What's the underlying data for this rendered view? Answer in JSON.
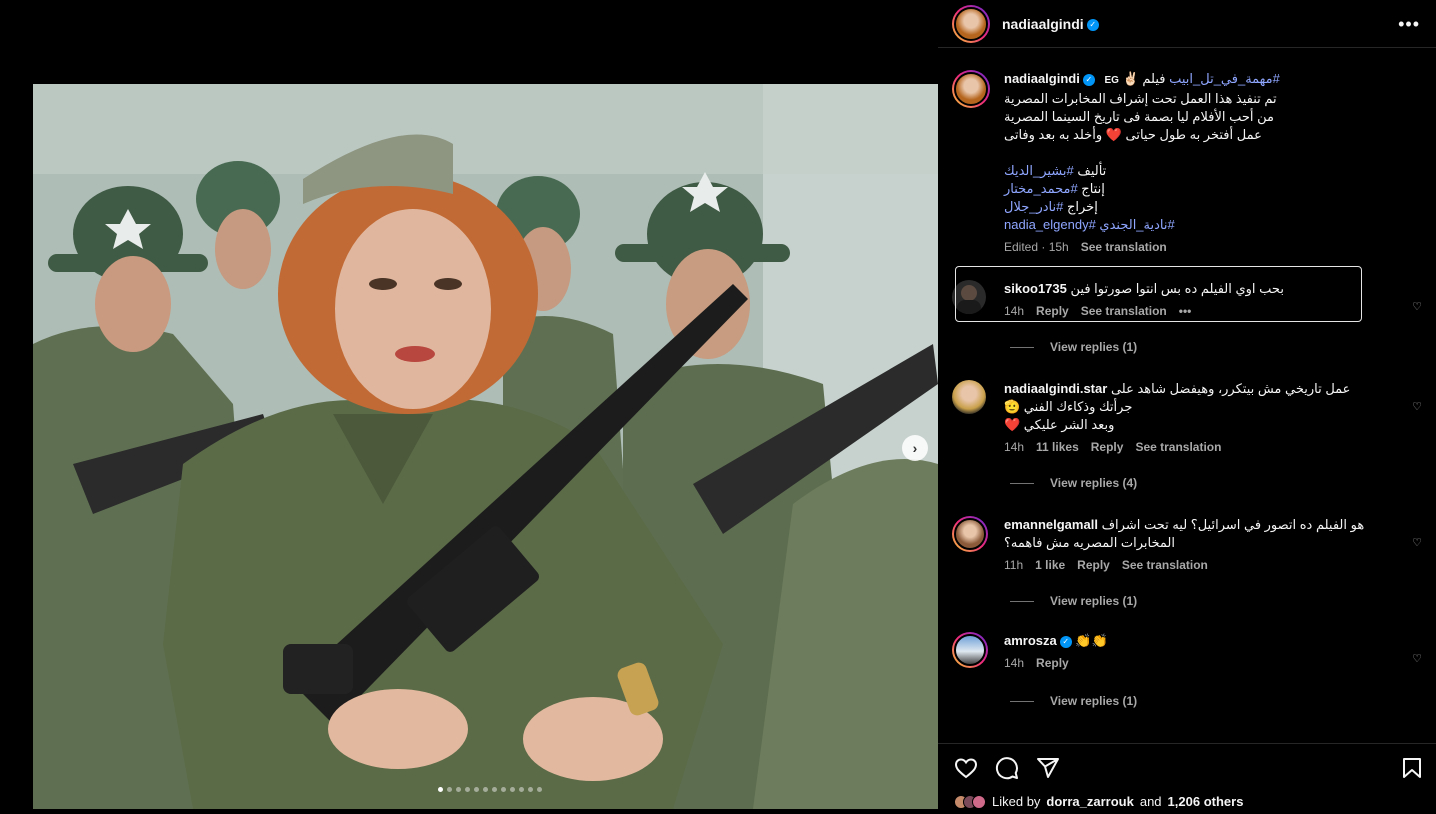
{
  "post": {
    "username": "nadiaalgindi",
    "more_label": "•••"
  },
  "caption": {
    "username": "nadiaalgindi",
    "country": "EG",
    "emoji": "✌🏻",
    "lines": [
      "فيلم #مهمة_في_تل_ابيب",
      "تم تنفيذ هذا العمل تحت إشراف المخابرات المصرية",
      "من أحب الأفلام ليا بصمة فى تاريخ السينما المصرية",
      "عمل أفتخر به طول حياتى ❤️ وأخلد به بعد وفاتى"
    ],
    "credits": [
      {
        "label": "تأليف",
        "tag": "#بشير_الديك"
      },
      {
        "label": "إنتاج",
        "tag": "#محمد_مختار"
      },
      {
        "label": "إخراج",
        "tag": "#نادر_جلال"
      }
    ],
    "tags_line": "nadia_elgendy# نادية_الجندي#",
    "edited": "Edited · 15h",
    "see_translation": "See translation"
  },
  "comments": [
    {
      "username": "sikoo1735",
      "text": "بحب اوي الفيلم ده بس انتوا صورتوا فين",
      "time": "14h",
      "reply": "Reply",
      "translate": "See translation",
      "more": "•••",
      "view_replies": "View replies (1)"
    },
    {
      "username": "nadiaalgindi.star",
      "text_lines": [
        "عمل تاريخي مش بيتكرر، وهيفضل شاهد على",
        "جرأتك وذكاءك الفني 🫡",
        "وبعد الشر عليكي ❤️"
      ],
      "time": "14h",
      "likes": "11 likes",
      "reply": "Reply",
      "translate": "See translation",
      "view_replies": "View replies (4)"
    },
    {
      "username": "emannelgamall",
      "text_lines": [
        "هو الفيلم ده اتصور في اسرائيل؟ ليه تحت اشراف",
        "المخابرات المصريه مش فاهمه؟"
      ],
      "time": "11h",
      "likes": "1 like",
      "reply": "Reply",
      "translate": "See translation",
      "view_replies": "View replies (1)"
    },
    {
      "username": "amrosza",
      "text": "👏👏",
      "time": "14h",
      "reply": "Reply",
      "view_replies": "View replies (1)"
    }
  ],
  "liked_by": {
    "prefix": "Liked by",
    "user": "dorra_zarrouk",
    "and": "and",
    "others": "1,206 others"
  },
  "colors": {
    "accent_tag": "#8fa6ff",
    "verified": "#0095f6",
    "muted": "#a8a8a8"
  }
}
